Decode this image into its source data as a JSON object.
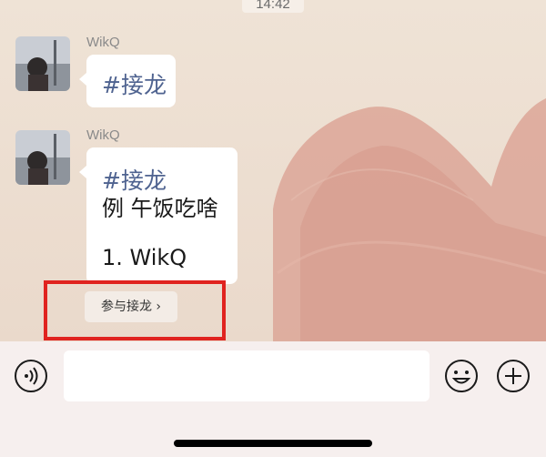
{
  "status": {
    "time": "14:42"
  },
  "messages": [
    {
      "sender": "WikQ",
      "tag": "#接龙",
      "lines": []
    },
    {
      "sender": "WikQ",
      "tag": "#接龙",
      "lines": [
        "例 午饭吃啥",
        "",
        "1. WikQ"
      ]
    }
  ],
  "solitaire": {
    "join_label": "参与接龙 ›"
  },
  "input_bar": {
    "voice_icon": "voice-icon",
    "emoji_icon": "emoji-icon",
    "plus_icon": "plus-icon"
  },
  "colors": {
    "highlight": "#e0231f",
    "tag_text": "#4f6390",
    "wallpaper_stroke": "#dca698"
  }
}
